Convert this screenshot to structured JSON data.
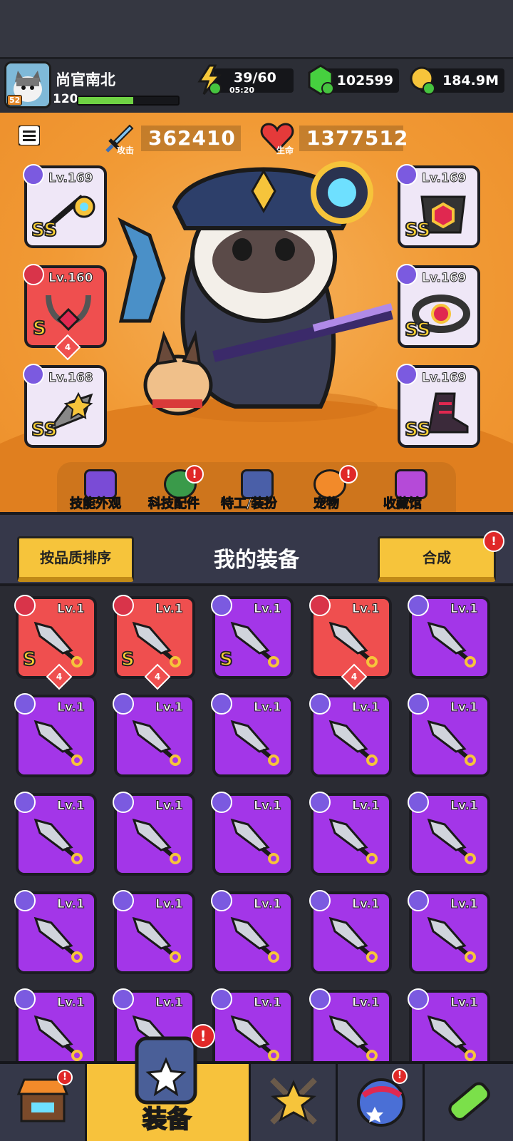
{
  "player": {
    "name": "尚官南北",
    "level": "120",
    "avatar_level": "52",
    "xp_fraction": 0.55
  },
  "resources": {
    "energy": {
      "value": "39/60",
      "timer": "05:20",
      "icon": "lightning-icon"
    },
    "gems": {
      "value": "102599",
      "icon": "green-gem-icon"
    },
    "coins": {
      "value": "184.9M",
      "icon": "gold-coin-icon"
    }
  },
  "stats": {
    "attack": {
      "value": "362410",
      "label": "攻击",
      "icon": "sword-icon"
    },
    "health": {
      "value": "1377512",
      "label": "生命",
      "icon": "heart-icon"
    }
  },
  "equipped_left": [
    {
      "level": "Lv.169",
      "tier": "SS",
      "slot_icon": "weapon-icon",
      "color": "light"
    },
    {
      "level": "Lv.160",
      "tier": "S",
      "slot_icon": "necklace-icon",
      "color": "red",
      "stars": "4"
    },
    {
      "level": "Lv.168",
      "tier": "SS",
      "slot_icon": "glove-icon",
      "color": "light"
    }
  ],
  "equipped_right": [
    {
      "level": "Lv.169",
      "tier": "SS",
      "slot_icon": "armor-icon",
      "color": "light"
    },
    {
      "level": "Lv.169",
      "tier": "SS",
      "slot_icon": "belt-icon",
      "color": "light"
    },
    {
      "level": "Lv.169",
      "tier": "SS",
      "slot_icon": "boot-icon",
      "color": "light"
    }
  ],
  "sub_nav": [
    {
      "label": "技能外观",
      "icon": "skin-hat-icon",
      "badge": false
    },
    {
      "label": "科技配件",
      "icon": "hex-chip-icon",
      "badge": true
    },
    {
      "label": "特工/装扮",
      "icon": "agent-icon",
      "badge": false
    },
    {
      "label": "宠物",
      "icon": "shiba-pet-icon",
      "badge": true
    },
    {
      "label": "收藏馆",
      "icon": "chest-icon",
      "badge": false
    }
  ],
  "inventory": {
    "title": "我的装备",
    "sort_label": "按品质排序",
    "merge_label": "合成",
    "items_row1": [
      {
        "level": "Lv.1",
        "color": "red",
        "tier": "S",
        "stars": "4",
        "icon": "armor-icon"
      },
      {
        "level": "Lv.1",
        "color": "red",
        "tier": "S",
        "stars": "4",
        "icon": "glove-icon"
      },
      {
        "level": "Lv.1",
        "color": "purple",
        "tier": "S",
        "stars": "",
        "icon": "belt-icon"
      },
      {
        "level": "Lv.1",
        "color": "red",
        "tier": "",
        "stars": "4",
        "icon": "glove-icon"
      },
      {
        "level": "Lv.1",
        "color": "purple",
        "tier": "",
        "stars": "",
        "icon": "kunai-icon"
      }
    ],
    "kunai_level": "Lv.1"
  },
  "bottom_nav": [
    {
      "label": "",
      "icon": "shop-icon",
      "badge": true
    },
    {
      "label": "装备",
      "icon": "equipment-icon",
      "badge": true
    },
    {
      "label": "",
      "icon": "star-swords-icon",
      "badge": false
    },
    {
      "label": "",
      "icon": "planet-icon",
      "badge": true
    },
    {
      "label": "",
      "icon": "dna-capsule-icon",
      "badge": false
    }
  ]
}
